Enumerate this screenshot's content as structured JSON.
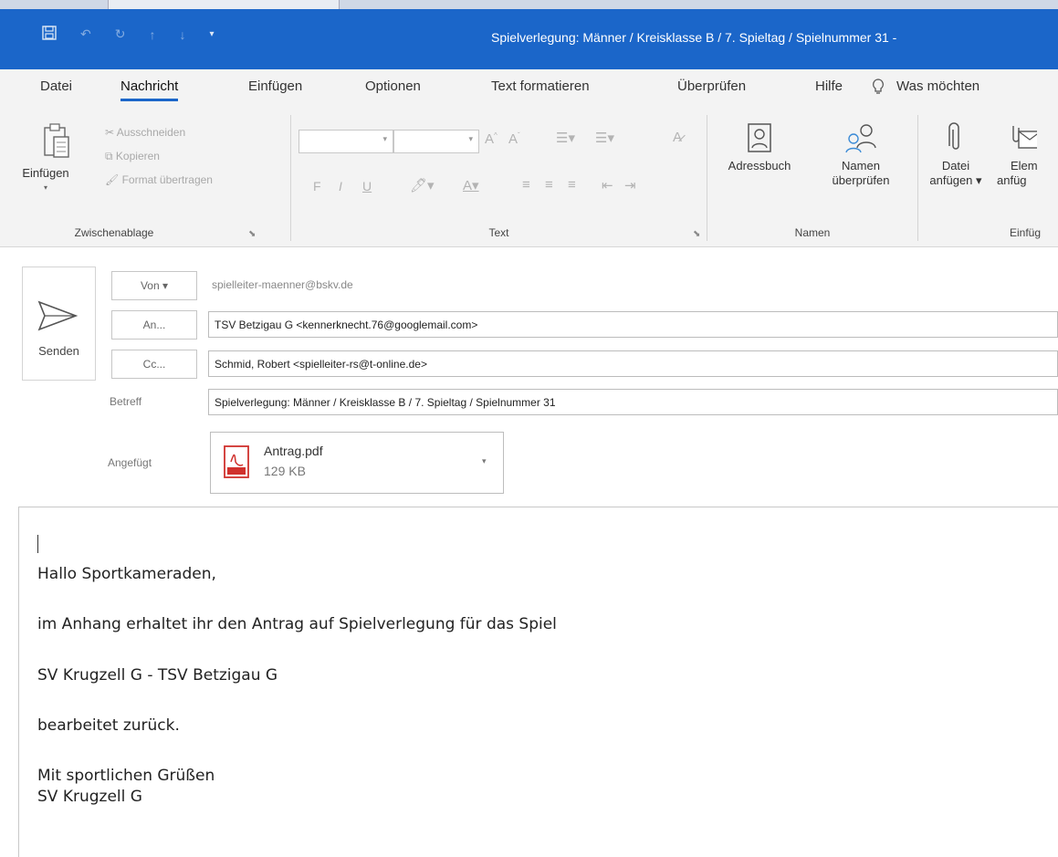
{
  "window": {
    "title": "Spielverlegung: Männer / Kreisklasse B / 7. Spieltag / Spielnummer 31  -",
    "quick_access": [
      "save-icon",
      "undo-icon",
      "redo-icon",
      "up-arrow-icon",
      "down-arrow-icon",
      "customize-icon"
    ]
  },
  "menu": {
    "tabs": [
      "Datei",
      "Nachricht",
      "Einfügen",
      "Optionen",
      "Text formatieren",
      "Überprüfen",
      "Hilfe"
    ],
    "active": "Nachricht",
    "tell_me": "Was möchten"
  },
  "ribbon": {
    "clipboard": {
      "paste": "Einfügen",
      "cut": "Ausschneiden",
      "copy": "Kopieren",
      "format_painter": "Format übertragen",
      "label": "Zwischenablage"
    },
    "text": {
      "label": "Text",
      "bold": "F",
      "italic": "I",
      "underline": "U"
    },
    "names": {
      "address_book": "Adressbuch",
      "check_names_line1": "Namen",
      "check_names_line2": "überprüfen",
      "label": "Namen"
    },
    "include": {
      "attach_file_line1": "Datei",
      "attach_file_line2": "anfügen ▾",
      "attach_item_line1": "Elem",
      "attach_item_line2": "anfüg",
      "label": "Einfüg"
    }
  },
  "compose": {
    "send": "Senden",
    "from_button": "Von ▾",
    "from_value": "spielleiter-maenner@bskv.de",
    "to_button": "An...",
    "to_value": "TSV Betzigau G <kennerknecht.76@googlemail.com>",
    "cc_button": "Cc...",
    "cc_value": "Schmid, Robert <spielleiter-rs@t-online.de>",
    "subject_label": "Betreff",
    "subject_value": "Spielverlegung: Männer / Kreisklasse B / 7. Spieltag / Spielnummer 31",
    "attached_label": "Angefügt",
    "attachment": {
      "name": "Antrag.pdf",
      "size": "129 KB",
      "icon_text": "PDF"
    }
  },
  "body": {
    "lines": [
      "Hallo Sportkameraden,",
      "im Anhang erhaltet ihr den Antrag auf Spielverlegung für das Spiel",
      "SV Krugzell G - TSV Betzigau G",
      "bearbeitet zurück.",
      "Mit sportlichen Grüßen",
      "SV Krugzell G"
    ]
  },
  "colors": {
    "accent": "#1b66c9",
    "ribbon_bg": "#f3f3f3",
    "pdf_red": "#d0312d"
  }
}
